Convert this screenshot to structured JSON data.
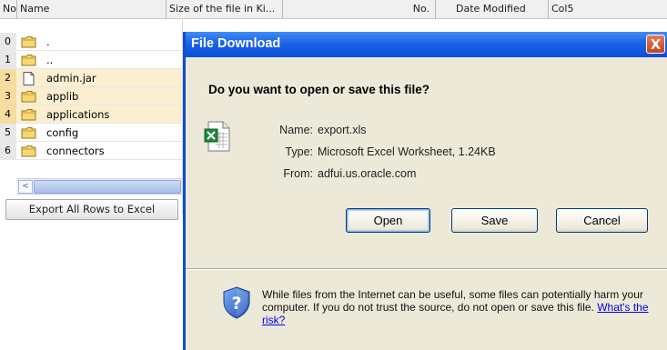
{
  "table": {
    "columns": [
      {
        "label": "No"
      },
      {
        "label": "Name"
      },
      {
        "label": "Size of the file in Ki..."
      },
      {
        "label": "No."
      },
      {
        "label": "Date Modified"
      },
      {
        "label": "Col5"
      }
    ],
    "rows": [
      {
        "no": "0",
        "name": ".",
        "icon": "folder-icon",
        "selected": false
      },
      {
        "no": "1",
        "name": "..",
        "icon": "folder-icon",
        "selected": false
      },
      {
        "no": "2",
        "name": "admin.jar",
        "icon": "file-icon",
        "selected": true
      },
      {
        "no": "3",
        "name": "applib",
        "icon": "folder-icon",
        "selected": true
      },
      {
        "no": "4",
        "name": "applications",
        "icon": "folder-icon",
        "selected": true
      },
      {
        "no": "5",
        "name": "config",
        "icon": "folder-icon",
        "selected": false
      },
      {
        "no": "6",
        "name": "connectors",
        "icon": "folder-icon",
        "selected": false
      }
    ],
    "scroll_left_glyph": "<",
    "export_label": "Export All Rows to Excel"
  },
  "dialog": {
    "title": "File Download",
    "close_glyph": "X",
    "question": "Do you want to open or save this file?",
    "file_icon": "excel-file-icon",
    "info": {
      "name_label": "Name:",
      "name_value": "export.xls",
      "type_label": "Type:",
      "type_value": "Microsoft Excel Worksheet, 1.24KB",
      "from_label": "From:",
      "from_value": "adfui.us.oracle.com"
    },
    "buttons": {
      "open": "Open",
      "save": "Save",
      "cancel": "Cancel"
    },
    "warning_text": "While files from the Internet can be useful, some files can potentially harm your computer. If you do not trust the source, do not open or save this file.",
    "risk_link": "What's the risk?",
    "warning_icon": "shield-question-icon"
  },
  "colors": {
    "titlebar": "#0a4fd8",
    "dialog_bg": "#ece9d8",
    "selected_row": "#fbefd0",
    "folder": "#f2c94c"
  }
}
